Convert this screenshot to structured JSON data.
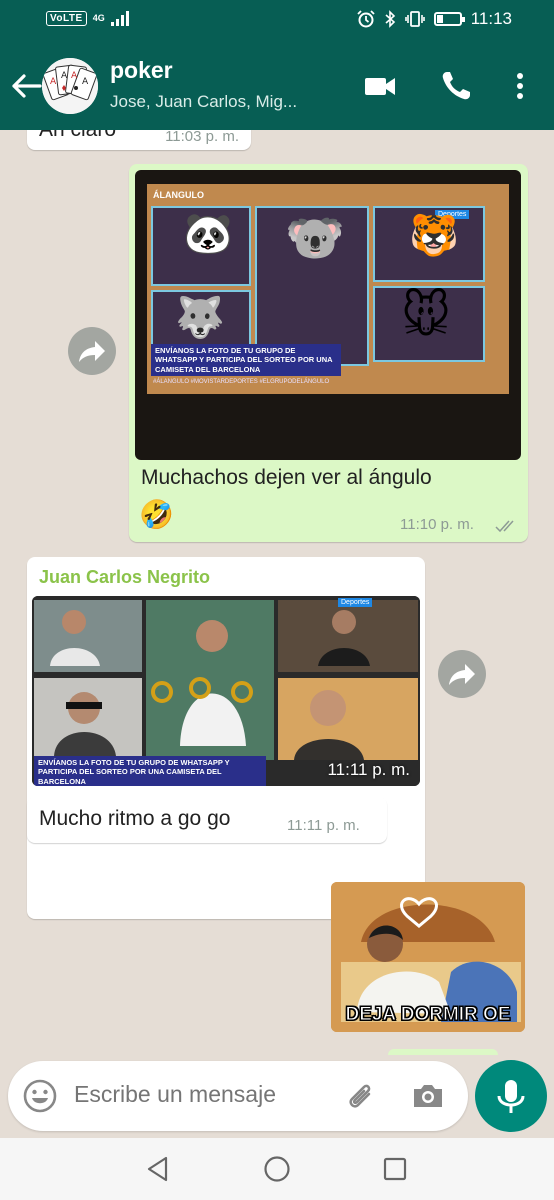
{
  "status_bar": {
    "volte": "VoLTE",
    "network": "4G",
    "time": "11:13",
    "battery_level": 0.25,
    "icons": [
      "alarm-icon",
      "bluetooth-icon",
      "vibrate-icon",
      "battery-icon"
    ]
  },
  "header": {
    "title": "poker",
    "subtitle": "Jose, Juan Carlos, Mig...",
    "icons": [
      "back-arrow-icon",
      "group-avatar",
      "video-call-icon",
      "phone-icon",
      "more-vert-icon"
    ]
  },
  "messages": [
    {
      "type": "text",
      "direction": "incoming",
      "text": "Ah claro",
      "time": "11:03 p. m."
    },
    {
      "type": "image",
      "direction": "outgoing",
      "image_overlays": {
        "logo": "ÁLANGULO",
        "banner": "ENVÍANOS LA FOTO DE TU GRUPO DE WHATSAPP Y PARTICIPA DEL SORTEO POR UNA CAMISETA DEL BARCELONA",
        "footer": "#ÁLANGULO #MOVISTARDEPORTES #ELGRUPODELÁNGULO",
        "channel": "Deportes"
      },
      "caption": "Muchachos dejen ver al ángulo",
      "caption_emoji": "🤣",
      "time": "11:10 p. m.",
      "status": "read"
    },
    {
      "type": "image",
      "direction": "incoming",
      "sender": "Juan Carlos Negrito",
      "image_overlays": {
        "banner": "ENVÍANOS LA FOTO DE TU GRUPO DE WHATSAPP Y PARTICIPA DEL SORTEO POR UNA CAMISETA DEL BARCELONA",
        "channel": "Deportes"
      },
      "time": "11:11 p. m."
    },
    {
      "type": "text",
      "direction": "incoming",
      "text": "Mucho ritmo a go go",
      "time": "11:11 p. m."
    },
    {
      "type": "sticker",
      "direction": "outgoing",
      "text": "DEJA DORMIR OE"
    }
  ],
  "input": {
    "placeholder": "Escribe un mensaje",
    "icons": [
      "emoji-icon",
      "attach-icon",
      "camera-icon",
      "mic-icon"
    ]
  },
  "nav_bar": {
    "icons": [
      "back-triangle-icon",
      "home-circle-icon",
      "recents-square-icon"
    ]
  },
  "colors": {
    "header": "#075e54",
    "chat_bg": "#e5ddd5",
    "outgoing": "#dcf8c6",
    "incoming": "#ffffff",
    "sender_name": "#8bc34a",
    "fab": "#00897b"
  }
}
